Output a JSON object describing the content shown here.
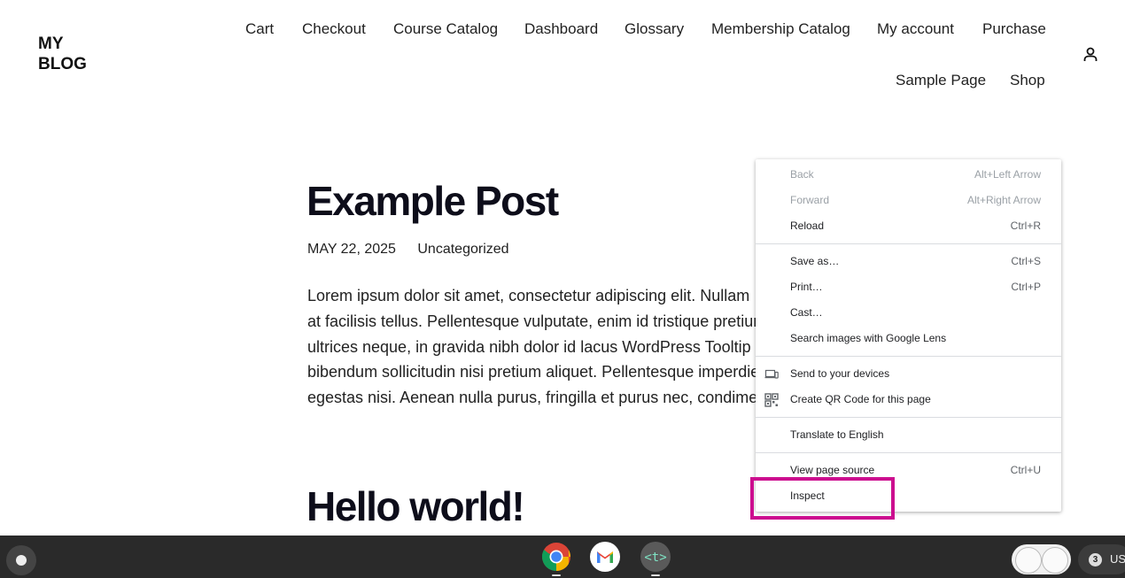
{
  "site": {
    "title_line1": "MY",
    "title_line2": "BLOG"
  },
  "nav": {
    "row1": [
      "Cart",
      "Checkout",
      "Course Catalog",
      "Dashboard",
      "Glossary",
      "Membership Catalog",
      "My account",
      "Purchase"
    ],
    "row2": [
      "Sample Page",
      "Shop"
    ]
  },
  "header_icon": "user-account-icon",
  "post": {
    "title": "Example Post",
    "date": "MAY 22, 2025",
    "category": "Uncategorized",
    "body_lines": [
      "Lorem ipsum dolor sit amet, consectetur adipiscing elit. Nullam",
      "at facilisis tellus. Pellentesque vulputate, enim id tristique pretium",
      "ultrices neque, in gravida nibh dolor id lacus WordPress Tooltip",
      "bibendum sollicitudin nisi pretium aliquet. Pellentesque imperdiet",
      "egestas nisi. Aenean nulla purus, fringilla et purus nec, condimentum"
    ]
  },
  "next_post": {
    "title": "Hello world!"
  },
  "context_menu": {
    "items": [
      {
        "label": "Back",
        "shortcut": "Alt+Left Arrow",
        "disabled": true
      },
      {
        "label": "Forward",
        "shortcut": "Alt+Right Arrow",
        "disabled": true
      },
      {
        "label": "Reload",
        "shortcut": "Ctrl+R"
      },
      {
        "label": "Save as…",
        "shortcut": "Ctrl+S"
      },
      {
        "label": "Print…",
        "shortcut": "Ctrl+P"
      },
      {
        "label": "Cast…",
        "shortcut": ""
      },
      {
        "label": "Search images with Google Lens",
        "shortcut": ""
      },
      {
        "label": "Send to your devices",
        "shortcut": "",
        "icon": "devices-icon"
      },
      {
        "label": "Create QR Code for this page",
        "shortcut": "",
        "icon": "qr-code-icon"
      },
      {
        "label": "Translate to English",
        "shortcut": ""
      },
      {
        "label": "View page source",
        "shortcut": "Ctrl+U"
      },
      {
        "label": "Inspect",
        "shortcut": "",
        "highlighted": true
      }
    ],
    "highlight_color": "#cc0e8f"
  },
  "taskbar": {
    "apps": [
      "chrome-icon",
      "gmail-icon",
      "terminal-icon"
    ],
    "notification_count": "3",
    "language": "US"
  }
}
